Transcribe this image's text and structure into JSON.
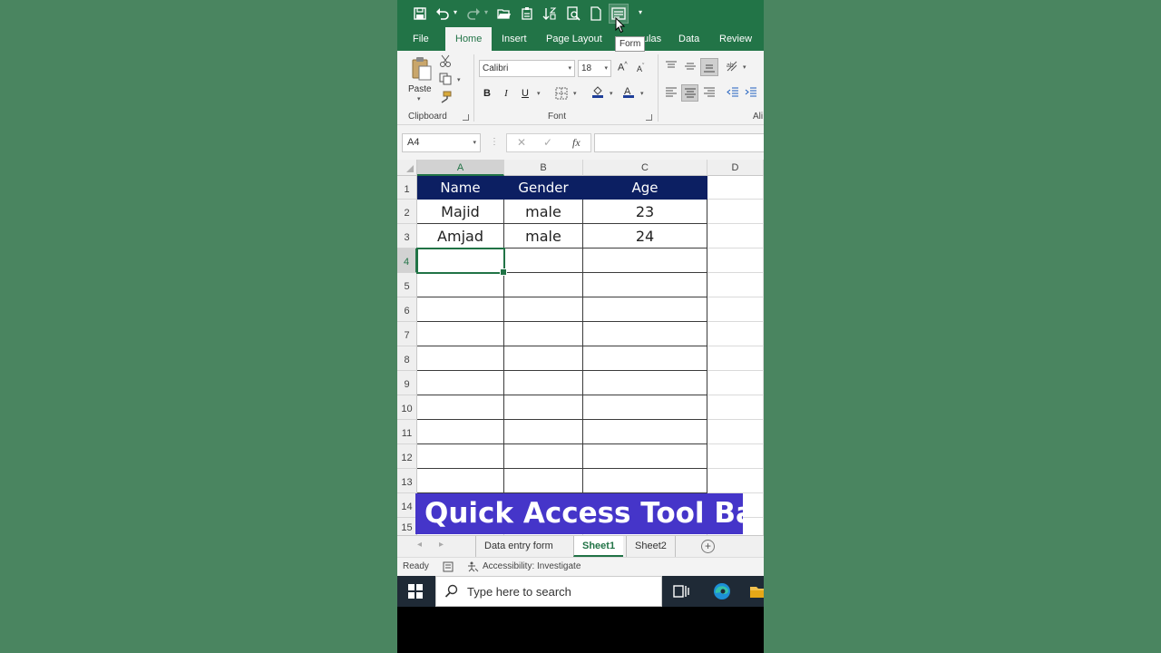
{
  "colors": {
    "excel_green": "#227447",
    "header_fill": "#0c1f62",
    "banner": "#4535c9",
    "backdrop": "#4a8560"
  },
  "qat": {
    "icons": [
      "save-icon",
      "undo-icon",
      "redo-icon",
      "open-icon",
      "paste-special-icon",
      "sort-icon",
      "print-preview-icon",
      "new-icon",
      "form-icon",
      "customize-icon"
    ],
    "tooltip": "Form"
  },
  "ribbon": {
    "tabs": [
      "File",
      "Home",
      "Insert",
      "Page Layout",
      "Formulas",
      "Data",
      "Review"
    ],
    "tab_visible_text": {
      "formulas": "ulas"
    },
    "clipboard": {
      "paste": "Paste",
      "group": "Clipboard"
    },
    "font": {
      "name": "Calibri",
      "size": "18",
      "bold": "B",
      "italic": "I",
      "underline": "U",
      "group": "Font"
    },
    "alignment": {
      "group_fragment": "Ali"
    }
  },
  "formula_bar": {
    "name_box": "A4",
    "fx": "fx",
    "content": ""
  },
  "grid": {
    "columns": [
      "A",
      "B",
      "C",
      "D"
    ],
    "rows": [
      "1",
      "2",
      "3",
      "4",
      "5",
      "6",
      "7",
      "8",
      "9",
      "10",
      "11",
      "12",
      "13",
      "14",
      "15"
    ],
    "table": {
      "headers": [
        "Name",
        "Gender",
        "Age"
      ],
      "rows": [
        [
          "Majid",
          "male",
          "23"
        ],
        [
          "Amjad",
          "male",
          "24"
        ]
      ]
    },
    "active_cell": "A4"
  },
  "banner": "Quick Access Tool Bar",
  "sheets": {
    "tabs": [
      "Data entry form",
      "Sheet1",
      "Sheet2"
    ],
    "active": "Sheet1"
  },
  "status": {
    "ready": "Ready",
    "accessibility": "Accessibility: Investigate"
  },
  "taskbar": {
    "search_placeholder": "Type here to search"
  }
}
